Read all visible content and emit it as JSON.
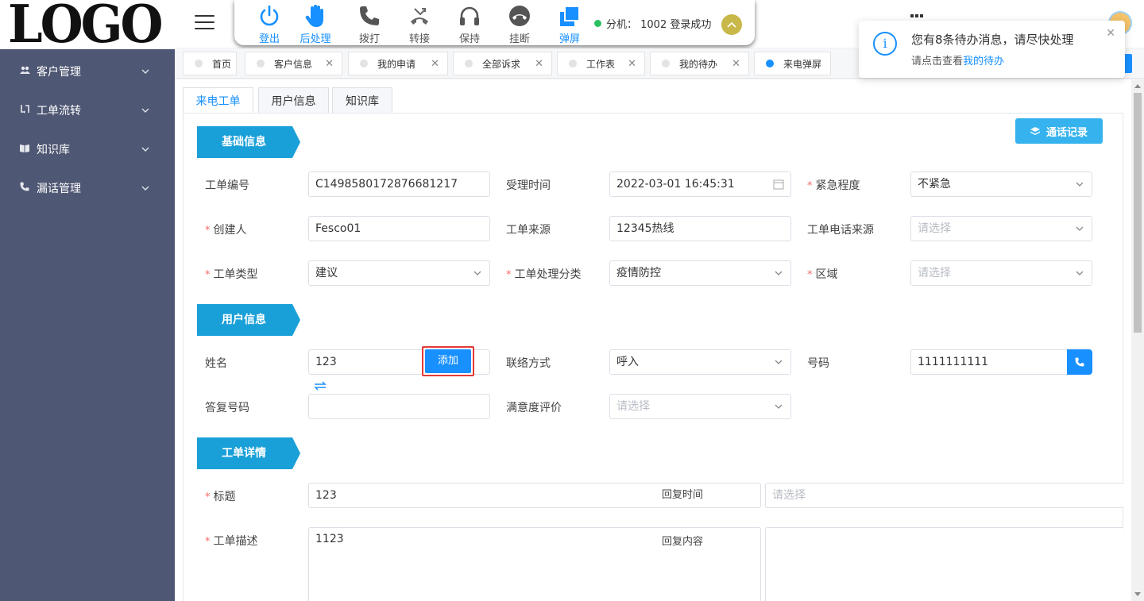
{
  "logo": "LOGO",
  "sidebar": {
    "items": [
      {
        "label": "客户管理",
        "icon": "users-icon"
      },
      {
        "label": "工单流转",
        "icon": "transfer-icon"
      },
      {
        "label": "知识库",
        "icon": "book-icon"
      },
      {
        "label": "漏话管理",
        "icon": "phone-icon"
      }
    ]
  },
  "phonebar": {
    "buttons": {
      "logout": "登出",
      "post_process": "后处理",
      "dial": "拨打",
      "transfer": "转接",
      "hold": "保持",
      "hangup": "挂断",
      "popup": "弹屏"
    },
    "status": "分机： 1002 登录成功"
  },
  "page_tabs": [
    {
      "label": "首页"
    },
    {
      "label": "客户信息"
    },
    {
      "label": "我的申请"
    },
    {
      "label": "全部诉求"
    },
    {
      "label": "工作表"
    },
    {
      "label": "我的待办"
    },
    {
      "label": "来电弹屏"
    }
  ],
  "sub_tabs": [
    "来电工单",
    "用户信息",
    "知识库"
  ],
  "call_log_button": "通话记录",
  "sections": {
    "basic": "基础信息",
    "user": "用户信息",
    "detail": "工单详情"
  },
  "form": {
    "order_no_label": "工单编号",
    "order_no": "C1498580172876681217",
    "accept_time_label": "受理时间",
    "accept_time": "2022-03-01 16:45:31",
    "urgency_label": "紧急程度",
    "urgency": "不紧急",
    "creator_label": "创建人",
    "creator": "Fesco01",
    "source_label": "工单来源",
    "source": "12345热线",
    "phone_source_label": "工单电话来源",
    "phone_source_placeholder": "请选择",
    "type_label": "工单类型",
    "type": "建议",
    "category_label": "工单处理分类",
    "category": "疫情防控",
    "area_label": "区域",
    "area_placeholder": "请选择",
    "name_label": "姓名",
    "name": "123",
    "add_button": "添加",
    "contact_label": "联络方式",
    "contact": "呼入",
    "number_label": "号码",
    "number": "1111111111",
    "reply_number_label": "答复号码",
    "satisfaction_label": "满意度评价",
    "satisfaction_placeholder": "请选择",
    "title_label": "标题",
    "title": "123",
    "reply_time_label": "回复时间",
    "reply_time_placeholder": "请选择",
    "desc_label": "工单描述",
    "desc": "1123",
    "reply_content_label": "回复内容"
  },
  "notification": {
    "title": "您有8条待办消息，请尽快处理",
    "message_prefix": "请点击查看",
    "link": "我的待办"
  },
  "colors": {
    "sidebar": "#4e5773",
    "primary": "#1890ff",
    "section_tag": "#1aa0d8",
    "required": "#f56c6c"
  }
}
